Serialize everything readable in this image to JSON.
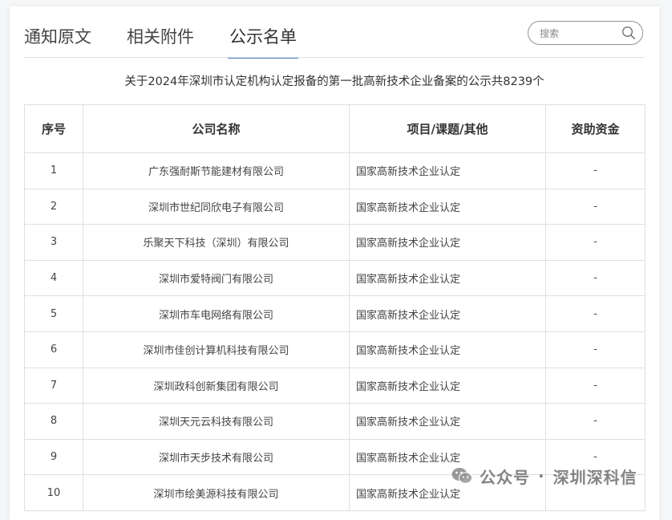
{
  "tabs": [
    {
      "label": "通知原文",
      "active": false
    },
    {
      "label": "相关附件",
      "active": false
    },
    {
      "label": "公示名单",
      "active": true
    }
  ],
  "search": {
    "placeholder": "搜索"
  },
  "notice": "关于2024年深圳市认定机构认定报备的第一批高新技术企业备案的公示共8239个",
  "table": {
    "headers": [
      "序号",
      "公司名称",
      "项目/课题/其他",
      "资助资金"
    ],
    "rows": [
      [
        "1",
        "广东强耐斯节能建材有限公司",
        "国家高新技术企业认定",
        "-"
      ],
      [
        "2",
        "深圳市世纪同欣电子有限公司",
        "国家高新技术企业认定",
        "-"
      ],
      [
        "3",
        "乐聚天下科技（深圳）有限公司",
        "国家高新技术企业认定",
        "-"
      ],
      [
        "4",
        "深圳市爱特阀门有限公司",
        "国家高新技术企业认定",
        "-"
      ],
      [
        "5",
        "深圳市车电网络有限公司",
        "国家高新技术企业认定",
        "-"
      ],
      [
        "6",
        "深圳市佳创计算机科技有限公司",
        "国家高新技术企业认定",
        "-"
      ],
      [
        "7",
        "深圳政科创新集团有限公司",
        "国家高新技术企业认定",
        "-"
      ],
      [
        "8",
        "深圳天元云科技有限公司",
        "国家高新技术企业认定",
        "-"
      ],
      [
        "9",
        "深圳市天步技术有限公司",
        "国家高新技术企业认定",
        "-"
      ],
      [
        "10",
        "深圳市绘美源科技有限公司",
        "国家高新技术企业认定",
        ""
      ]
    ]
  },
  "watermark": {
    "prefix": "公众号",
    "separator": "·",
    "name": "深圳深科信",
    "icon": "wechat-icon"
  },
  "colors": {
    "accent": "#4f84c4",
    "border": "#dcdfe4"
  }
}
